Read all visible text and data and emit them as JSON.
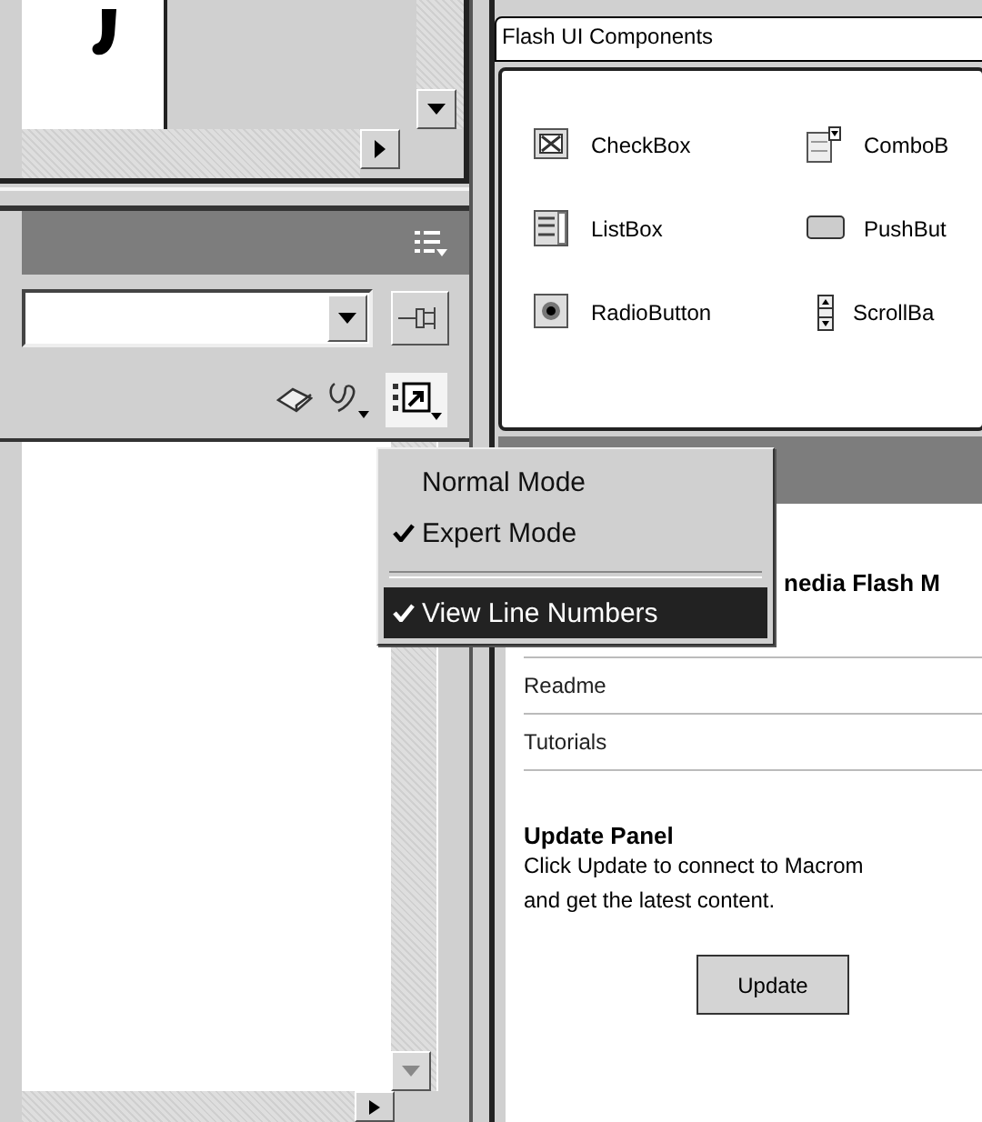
{
  "view_options_menu": {
    "items": [
      {
        "kind": "item",
        "label": "Normal Mode",
        "checked": false,
        "selected": false
      },
      {
        "kind": "item",
        "label": "Expert Mode",
        "checked": true,
        "selected": false
      },
      {
        "kind": "separator"
      },
      {
        "kind": "item",
        "label": "View Line Numbers",
        "checked": true,
        "selected": true
      }
    ]
  },
  "components_panel": {
    "library": "Flash UI Components",
    "components": [
      {
        "kind": "checkbox",
        "label": "CheckBox"
      },
      {
        "kind": "combobox",
        "label": "ComboB"
      },
      {
        "kind": "listbox",
        "label": "ListBox"
      },
      {
        "kind": "pushbutton",
        "label": "PushBut"
      },
      {
        "kind": "radiobutton",
        "label": "RadioButton"
      },
      {
        "kind": "scrollbar",
        "label": "ScrollBa"
      }
    ]
  },
  "welcome_panel": {
    "title": "nedia Flash M",
    "links": [
      "Readme",
      "Tutorials"
    ],
    "update_heading": "Update Panel",
    "update_lines": [
      "Click Update to connect to Macrom",
      "and get the latest content."
    ],
    "update_button": "Update"
  }
}
